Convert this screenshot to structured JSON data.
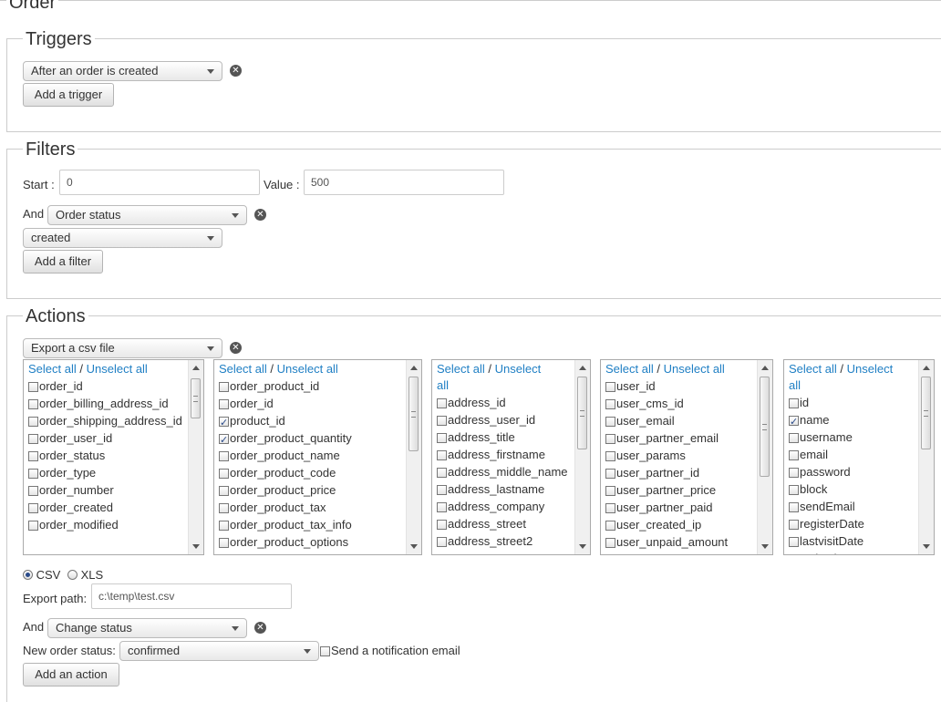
{
  "page": {
    "title": "Order"
  },
  "triggers": {
    "legend": "Triggers",
    "trigger_select": "After an order is created",
    "add_label": "Add a trigger"
  },
  "filters": {
    "legend": "Filters",
    "start_label": "Start :",
    "start_value": "0",
    "value_label": "Value :",
    "value_value": "500",
    "and_label": "And",
    "filter_select": "Order status",
    "status_select": "created",
    "add_label": "Add a filter"
  },
  "actions": {
    "legend": "Actions",
    "action_select": "Export a csv file",
    "select_all": "Select all",
    "separator": "/",
    "unselect_all": "Unselect all",
    "unselect_word": "Unselect",
    "all_word": "all",
    "lists": [
      {
        "items": [
          {
            "label": "order_id",
            "checked": false
          },
          {
            "label": "order_billing_address_id",
            "checked": false
          },
          {
            "label": "order_shipping_address_id",
            "checked": false
          },
          {
            "label": "order_user_id",
            "checked": false
          },
          {
            "label": "order_status",
            "checked": false
          },
          {
            "label": "order_type",
            "checked": false
          },
          {
            "label": "order_number",
            "checked": false
          },
          {
            "label": "order_created",
            "checked": false
          },
          {
            "label": "order_modified",
            "checked": false
          }
        ]
      },
      {
        "items": [
          {
            "label": "order_product_id",
            "checked": false
          },
          {
            "label": "order_id",
            "checked": false
          },
          {
            "label": "product_id",
            "checked": true
          },
          {
            "label": "order_product_quantity",
            "checked": true
          },
          {
            "label": "order_product_name",
            "checked": false
          },
          {
            "label": "order_product_code",
            "checked": false
          },
          {
            "label": "order_product_price",
            "checked": false
          },
          {
            "label": "order_product_tax",
            "checked": false
          },
          {
            "label": "order_product_tax_info",
            "checked": false
          },
          {
            "label": "order_product_options",
            "checked": false
          }
        ]
      },
      {
        "items": [
          {
            "label": "address_id",
            "checked": false
          },
          {
            "label": "address_user_id",
            "checked": false
          },
          {
            "label": "address_title",
            "checked": false
          },
          {
            "label": "address_firstname",
            "checked": false
          },
          {
            "label": "address_middle_name",
            "checked": false
          },
          {
            "label": "address_lastname",
            "checked": false
          },
          {
            "label": "address_company",
            "checked": false
          },
          {
            "label": "address_street",
            "checked": false
          },
          {
            "label": "address_street2",
            "checked": false
          }
        ]
      },
      {
        "items": [
          {
            "label": "user_id",
            "checked": false
          },
          {
            "label": "user_cms_id",
            "checked": false
          },
          {
            "label": "user_email",
            "checked": false
          },
          {
            "label": "user_partner_email",
            "checked": false
          },
          {
            "label": "user_params",
            "checked": false
          },
          {
            "label": "user_partner_id",
            "checked": false
          },
          {
            "label": "user_partner_price",
            "checked": false
          },
          {
            "label": "user_partner_paid",
            "checked": false
          },
          {
            "label": "user_created_ip",
            "checked": false
          },
          {
            "label": "user_unpaid_amount",
            "checked": false
          }
        ]
      },
      {
        "items": [
          {
            "label": "id",
            "checked": false
          },
          {
            "label": "name",
            "checked": true
          },
          {
            "label": "username",
            "checked": false
          },
          {
            "label": "email",
            "checked": false
          },
          {
            "label": "password",
            "checked": false
          },
          {
            "label": "block",
            "checked": false
          },
          {
            "label": "sendEmail",
            "checked": false
          },
          {
            "label": "registerDate",
            "checked": false
          },
          {
            "label": "lastvisitDate",
            "checked": false
          },
          {
            "label": "activation",
            "checked": false
          }
        ]
      }
    ],
    "format_csv": "CSV",
    "format_xls": "XLS",
    "format_selected": "CSV",
    "export_path_label": "Export path:",
    "export_path_value": "c:\\temp\\test.csv",
    "and_label": "And",
    "change_select": "Change status",
    "new_status_label": "New order status:",
    "new_status_select": "confirmed",
    "notify_label": "Send a notification email",
    "add_label": "Add an action"
  },
  "icons": {
    "remove": "remove-circle-icon",
    "dropdown": "chevron-down-icon"
  },
  "colors": {
    "link": "#1f7fc4",
    "border": "#cccccc",
    "check": "#2a4a8a"
  }
}
